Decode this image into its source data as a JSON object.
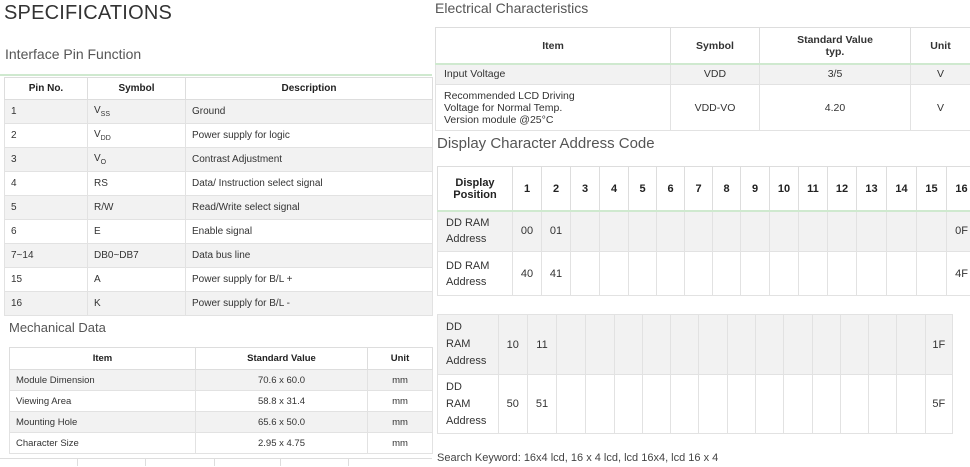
{
  "left": {
    "title": "SPECIFICATIONS",
    "pin_section_title": "Interface Pin Function",
    "pin_headers": [
      "Pin No.",
      "Symbol",
      "Description"
    ],
    "pins": [
      {
        "no": "1",
        "sym": "V",
        "sub": "SS",
        "desc": "Ground"
      },
      {
        "no": "2",
        "sym": "V",
        "sub": "DD",
        "desc": "Power supply for logic"
      },
      {
        "no": "3",
        "sym": "V",
        "sub": "O",
        "desc": "Contrast Adjustment"
      },
      {
        "no": "4",
        "sym": "RS",
        "sub": "",
        "desc": "Data/ Instruction  select signal"
      },
      {
        "no": "5",
        "sym": "R/W",
        "sub": "",
        "desc": "Read/Write select signal"
      },
      {
        "no": "6",
        "sym": "E",
        "sub": "",
        "desc": "Enable signal"
      },
      {
        "no": "7~14",
        "sym": "DB0~DB7",
        "sub": "",
        "desc": "Data bus line"
      },
      {
        "no": "15",
        "sym": "A",
        "sub": "",
        "desc": "Power supply for B/L +"
      },
      {
        "no": "16",
        "sym": "K",
        "sub": "",
        "desc": "Power supply for B/L -"
      }
    ],
    "mech_section_title": "Mechanical Data",
    "mech_headers": [
      "Item",
      "Standard Value",
      "Unit"
    ],
    "mech": [
      {
        "item": "Module Dimension",
        "value": "70.6 x 60.0",
        "unit": "mm"
      },
      {
        "item": "Viewing Area",
        "value": "58.8 x 31.4",
        "unit": "mm"
      },
      {
        "item": "Mounting Hole",
        "value": "65.6 x 50.0",
        "unit": "mm"
      },
      {
        "item": "Character Size",
        "value": "2.95 x 4.75",
        "unit": "mm"
      }
    ]
  },
  "right": {
    "elec_title": "Electrical Characteristics",
    "elec_headers": {
      "item": "Item",
      "symbol": "Symbol",
      "std1": "Standard Value",
      "std2": "typ.",
      "unit": "Unit"
    },
    "elec_rows": [
      {
        "item": [
          "Input Voltage"
        ],
        "symbol": "VDD",
        "value": "3/5",
        "unit": "V"
      },
      {
        "item": [
          "Recommended LCD Driving",
          "Voltage for Normal Temp.",
          "Version module @25°C"
        ],
        "symbol": "VDD-VO",
        "value": "4.20",
        "unit": "V"
      }
    ],
    "disp_title": "Display Character Address Code",
    "disp_header": [
      "Display",
      "Position"
    ],
    "positions": [
      "1",
      "2",
      "3",
      "4",
      "5",
      "6",
      "7",
      "8",
      "9",
      "10",
      "11",
      "12",
      "13",
      "14",
      "15",
      "16"
    ],
    "rows_top": [
      {
        "label": [
          "DD RAM",
          "Address"
        ],
        "first": "00",
        "second": "01",
        "last": "0F"
      },
      {
        "label": [
          "DD RAM",
          "Address"
        ],
        "first": "40",
        "second": "41",
        "last": "4F"
      }
    ],
    "rows_bottom": [
      {
        "label": [
          "DD",
          "RAM",
          "Address"
        ],
        "first": "10",
        "second": "11",
        "last": "1F"
      },
      {
        "label": [
          "DD",
          "RAM",
          "Address"
        ],
        "first": "50",
        "second": "51",
        "last": "5F"
      }
    ],
    "keyword": "Search Keyword: 16x4 lcd, 16 x 4 lcd, lcd 16x4, lcd 16 x 4"
  }
}
